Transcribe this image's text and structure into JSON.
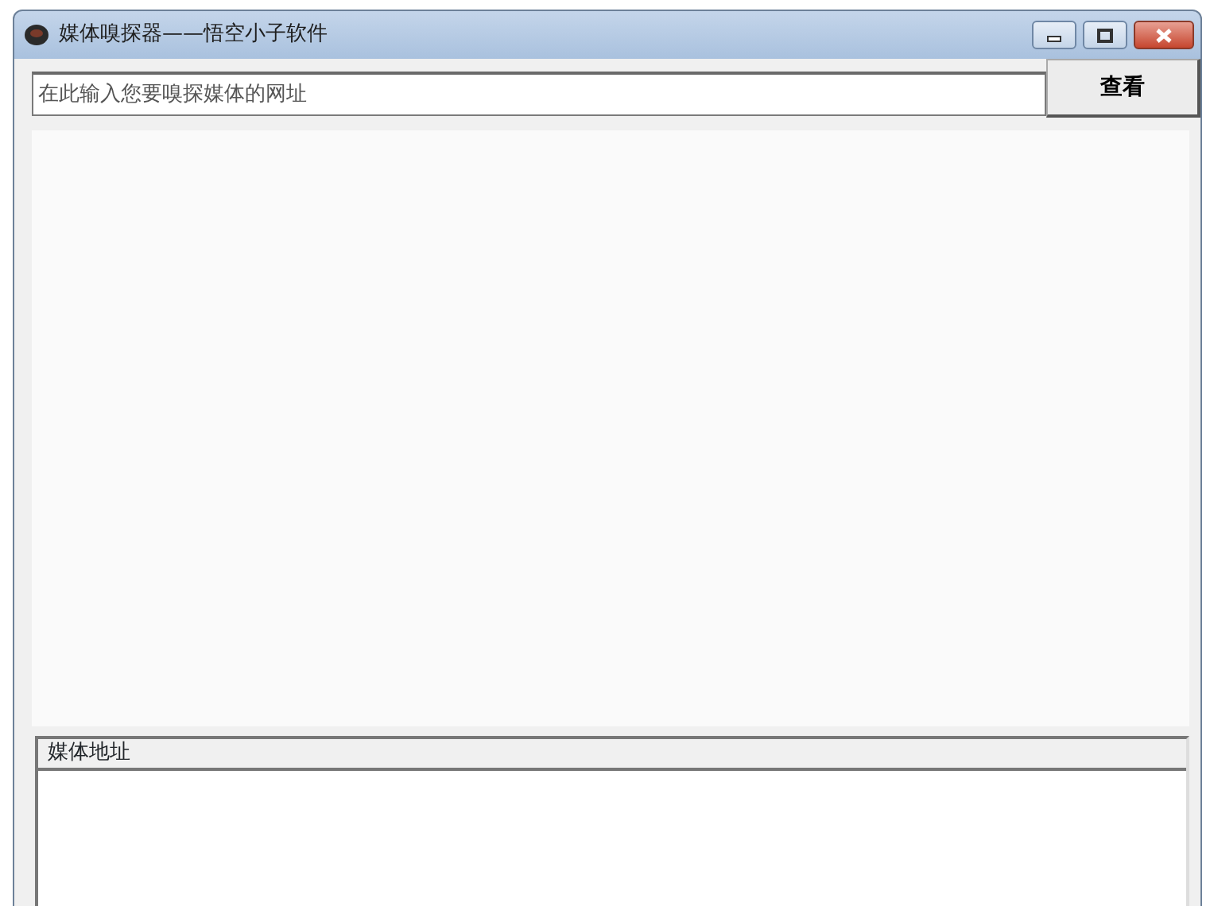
{
  "window": {
    "title": "媒体嗅探器——悟空小子软件",
    "controls": [
      {
        "kind": "minimize"
      },
      {
        "kind": "maximize"
      },
      {
        "kind": "close"
      }
    ]
  },
  "url_field": {
    "placeholder": "在此输入您要嗅探媒体的网址"
  },
  "view_button": {
    "label": "查看"
  },
  "media_list": {
    "columns": [
      "媒体地址"
    ]
  }
}
